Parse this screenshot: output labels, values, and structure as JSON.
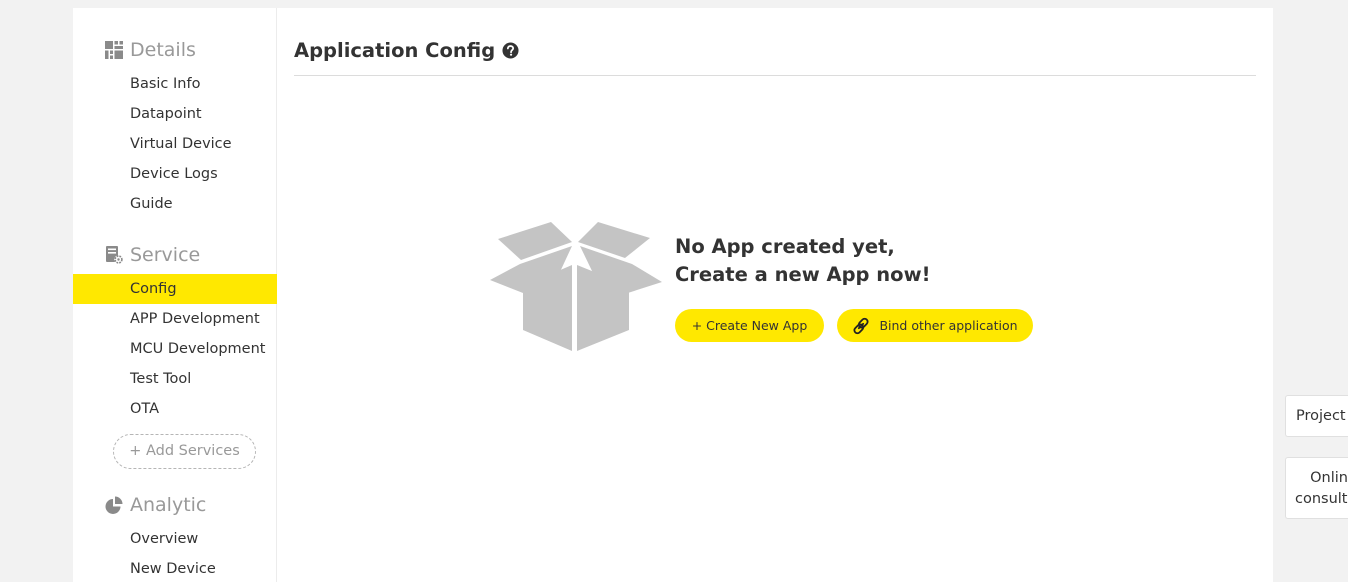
{
  "sidebar": {
    "sections": [
      {
        "label": "Details",
        "icon": "dashboard-grid-icon",
        "items": [
          "Basic Info",
          "Datapoint",
          "Virtual Device",
          "Device Logs",
          "Guide"
        ]
      },
      {
        "label": "Service",
        "icon": "server-gear-icon",
        "items": [
          "Config",
          "APP Development",
          "MCU Development",
          "Test Tool",
          "OTA"
        ]
      },
      {
        "label": "Analytic",
        "icon": "pie-chart-icon",
        "items": [
          "Overview",
          "New Device"
        ]
      }
    ],
    "active_item": "Config",
    "add_services_label": "+ Add Services"
  },
  "main": {
    "title": "Application Config",
    "help_icon": "question-circle-icon",
    "empty_state": {
      "icon": "open-box-icon",
      "line1": "No App created yet,",
      "line2": "Create a new App now!",
      "create_button": "+ Create New App",
      "bind_button": "Bind other application",
      "bind_icon": "link-icon"
    }
  },
  "floating": {
    "project": "Project",
    "online_line1": "Onlin",
    "online_line2": "consulta"
  },
  "colors": {
    "accent": "#ffe800",
    "background": "#f2f2f2",
    "muted_text": "#999999",
    "box_gray": "#c4c4c4"
  }
}
